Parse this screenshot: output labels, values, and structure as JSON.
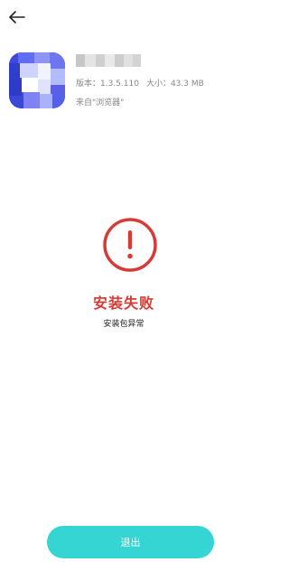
{
  "header": {
    "back_icon": "arrow-left-icon"
  },
  "app": {
    "icon": "app-icon-pixelated",
    "name_mask": "blurred-app-name",
    "version_text": "版本：1.3.5.110",
    "size_text": "大小：43.3 MB",
    "source_text": "来自\"浏览器\""
  },
  "status": {
    "icon": "alert-circle-icon",
    "title": "安装失败",
    "subtitle": "安装包异常",
    "accent_color": "#d83b35"
  },
  "actions": {
    "exit_label": "退出",
    "exit_color": "#34d5d3"
  }
}
